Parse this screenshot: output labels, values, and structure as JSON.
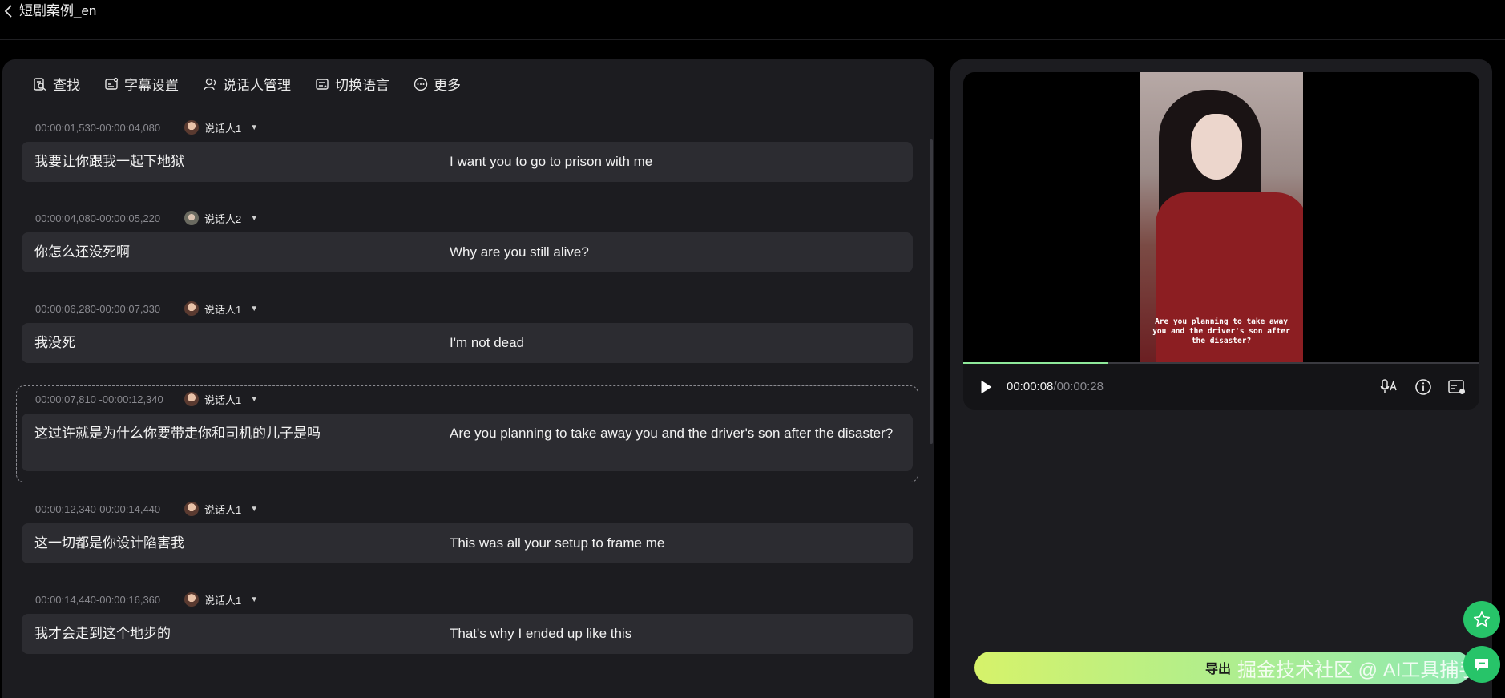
{
  "header": {
    "title": "短剧案例_en"
  },
  "toolbar": {
    "find": "查找",
    "subtitle_settings": "字幕设置",
    "speaker_manage": "说话人管理",
    "switch_language": "切换语言",
    "more": "更多"
  },
  "entries": [
    {
      "time": "00:00:01,530-00:00:04,080",
      "speaker": "说话人1",
      "source": "我要让你跟我一起下地狱",
      "target": "I want you to go to prison with me"
    },
    {
      "time": "00:00:04,080-00:00:05,220",
      "speaker": "说话人2",
      "source": "你怎么还没死啊",
      "target": "Why are you still alive?"
    },
    {
      "time": "00:00:06,280-00:00:07,330",
      "speaker": "说话人1",
      "source": "我没死",
      "target": "I'm not dead"
    },
    {
      "time": "00:00:07,810 -00:00:12,340",
      "speaker": "说话人1",
      "source": "这过许就是为什么你要带走你和司机的儿子是吗",
      "target": "Are you planning to take away you and the driver's son after the disaster?"
    },
    {
      "time": "00:00:12,340-00:00:14,440",
      "speaker": "说话人1",
      "source": "这一切都是你设计陷害我",
      "target": "This was all your setup to frame me"
    },
    {
      "time": "00:00:14,440-00:00:16,360",
      "speaker": "说话人1",
      "source": "我才会走到这个地步的",
      "target": "That's why I ended up like this"
    }
  ],
  "player": {
    "video_subtitle": "Are you planning to take away you and the driver's son after the disaster?",
    "current_time": "00:00:08",
    "separator": "/",
    "total_time": "00:00:28",
    "progress": 0.28
  },
  "export": {
    "label": "导出"
  },
  "watermark": {
    "text": "掘金技术社区 @ AI工具捕手"
  },
  "colors": {
    "accent": "#27c469",
    "export_start": "#d6f26a",
    "export_end": "#8fe9b2",
    "progress": "#8ee89a"
  },
  "icons": {
    "back": "chevron-left-icon",
    "find": "search-doc-icon",
    "subtitle": "subtitle-settings-icon",
    "speaker": "speaker-manage-icon",
    "language": "switch-language-icon",
    "more": "more-dots-icon",
    "play": "play-icon",
    "voice_translate": "voice-translate-icon",
    "info": "info-icon",
    "captions": "captions-icon",
    "star": "star-icon",
    "chat": "chat-icon"
  }
}
